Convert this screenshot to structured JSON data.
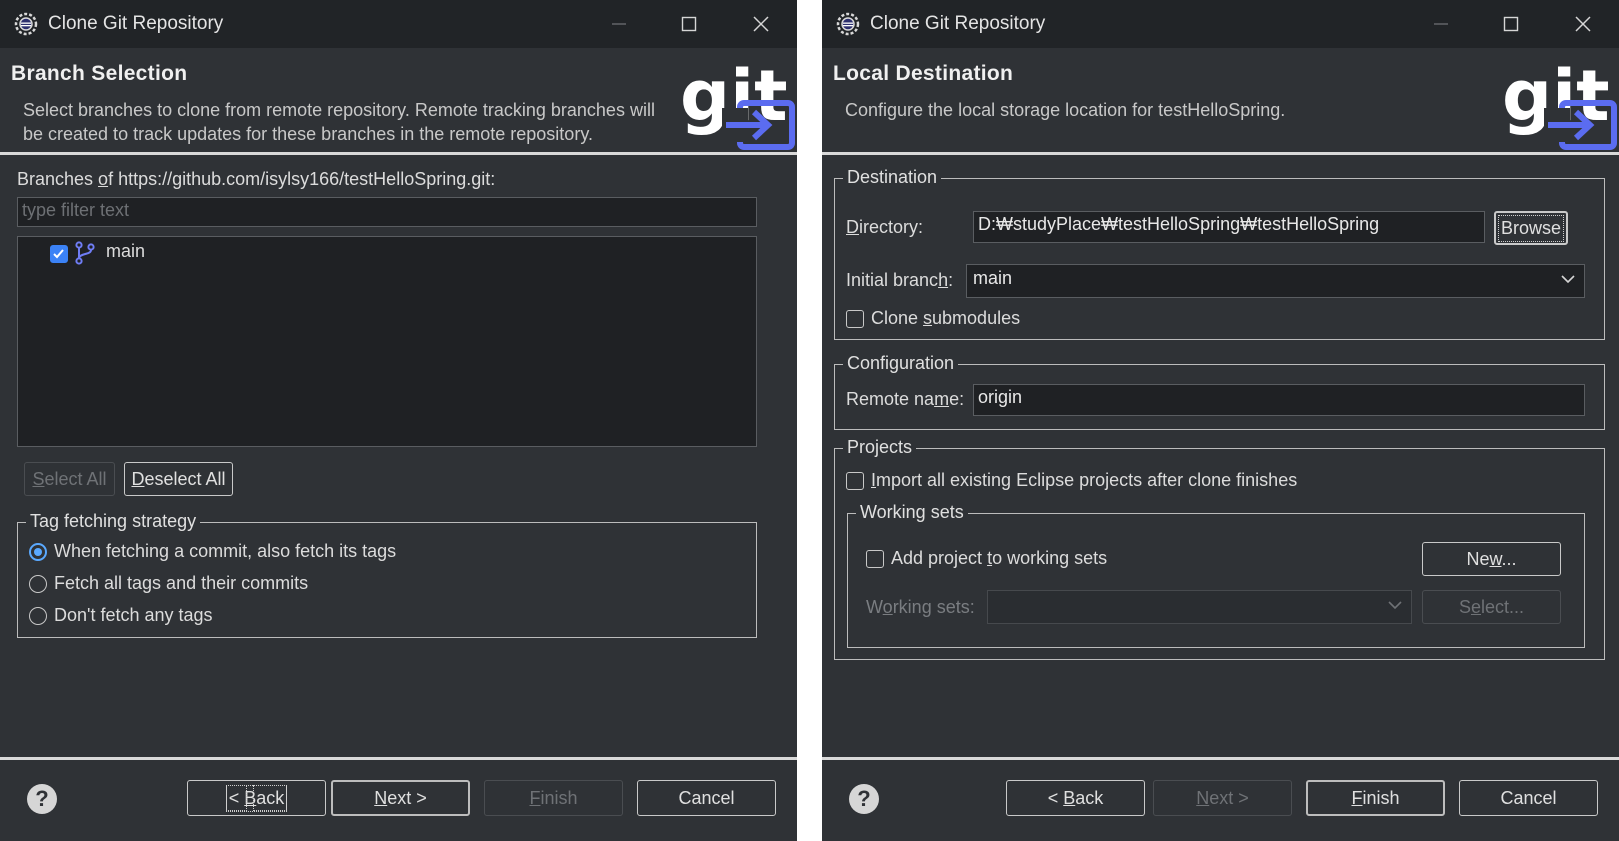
{
  "colors": {
    "accent": "#3b82f6",
    "radio_accent": "#5aa9ff",
    "git_logo_arrow": "#5b6cf0"
  },
  "left_window": {
    "title": "Clone Git Repository",
    "header": {
      "title": "Branch Selection",
      "description": "Select branches to clone from remote repository. Remote tracking branches will be created to track updates for these branches in the remote repository.",
      "logo_text": "git"
    },
    "branches_label_pre": "Branches ",
    "branches_label_u": "o",
    "branches_label_post": "f https://github.com/isylsy166/testHelloSpring.git:",
    "filter_placeholder": "type filter text",
    "branches": [
      {
        "name": "main",
        "checked": true,
        "icon": "branch-icon"
      }
    ],
    "select_all": {
      "u": "S",
      "rest": "elect All",
      "enabled": false
    },
    "deselect_all": {
      "u": "D",
      "rest": "eselect All",
      "enabled": true
    },
    "tag_group_title": "Tag fetching strategy",
    "tag_options": [
      {
        "label": "When fetching a commit, also fetch its tags",
        "selected": true
      },
      {
        "label": "Fetch all tags and their commits",
        "selected": false
      },
      {
        "label": "Don't fetch any tags",
        "selected": false
      }
    ],
    "footer": {
      "back": {
        "pre": "< ",
        "u": "B",
        "rest": "ack"
      },
      "next": {
        "u": "N",
        "rest": "ext >"
      },
      "finish": {
        "u": "F",
        "rest": "inish",
        "enabled": false
      },
      "cancel": "Cancel"
    }
  },
  "right_window": {
    "title": "Clone Git Repository",
    "header": {
      "title": "Local Destination",
      "description": "Configure the local storage location for testHelloSpring.",
      "logo_text": "git"
    },
    "destination": {
      "group_title": "Destination",
      "directory_label_u": "D",
      "directory_label_rest": "irectory:",
      "directory_value": "D:₩studyPlace₩testHelloSpring₩testHelloSpring",
      "browse": "Browse",
      "initial_branch_label_pre": "Initial branc",
      "initial_branch_label_u": "h",
      "initial_branch_label_post": ":",
      "initial_branch_value": "main",
      "clone_submodules_pre": "Clone ",
      "clone_submodules_u": "s",
      "clone_submodules_post": "ubmodules",
      "clone_submodules_checked": false
    },
    "configuration": {
      "group_title": "Configuration",
      "remote_label_pre": "Remote na",
      "remote_label_u": "m",
      "remote_label_post": "e:",
      "remote_value": "origin"
    },
    "projects": {
      "group_title": "Projects",
      "import_u": "I",
      "import_rest": "mport all existing Eclipse projects after clone finishes",
      "import_checked": false,
      "working_sets_title": "Working sets",
      "add_pre": "Add project ",
      "add_u": "t",
      "add_post": "o working sets",
      "add_checked": false,
      "new_pre": "Ne",
      "new_u": "w",
      "new_post": "...",
      "working_sets_label_pre": "W",
      "working_sets_label_u": "o",
      "working_sets_label_post": "rking sets:",
      "select_pre": "S",
      "select_u": "e",
      "select_post": "lect..."
    },
    "footer": {
      "back": {
        "pre": "< ",
        "u": "B",
        "rest": "ack"
      },
      "next": {
        "u": "N",
        "rest": "ext >",
        "enabled": false
      },
      "finish": {
        "u": "F",
        "rest": "inish"
      },
      "cancel": "Cancel"
    }
  }
}
